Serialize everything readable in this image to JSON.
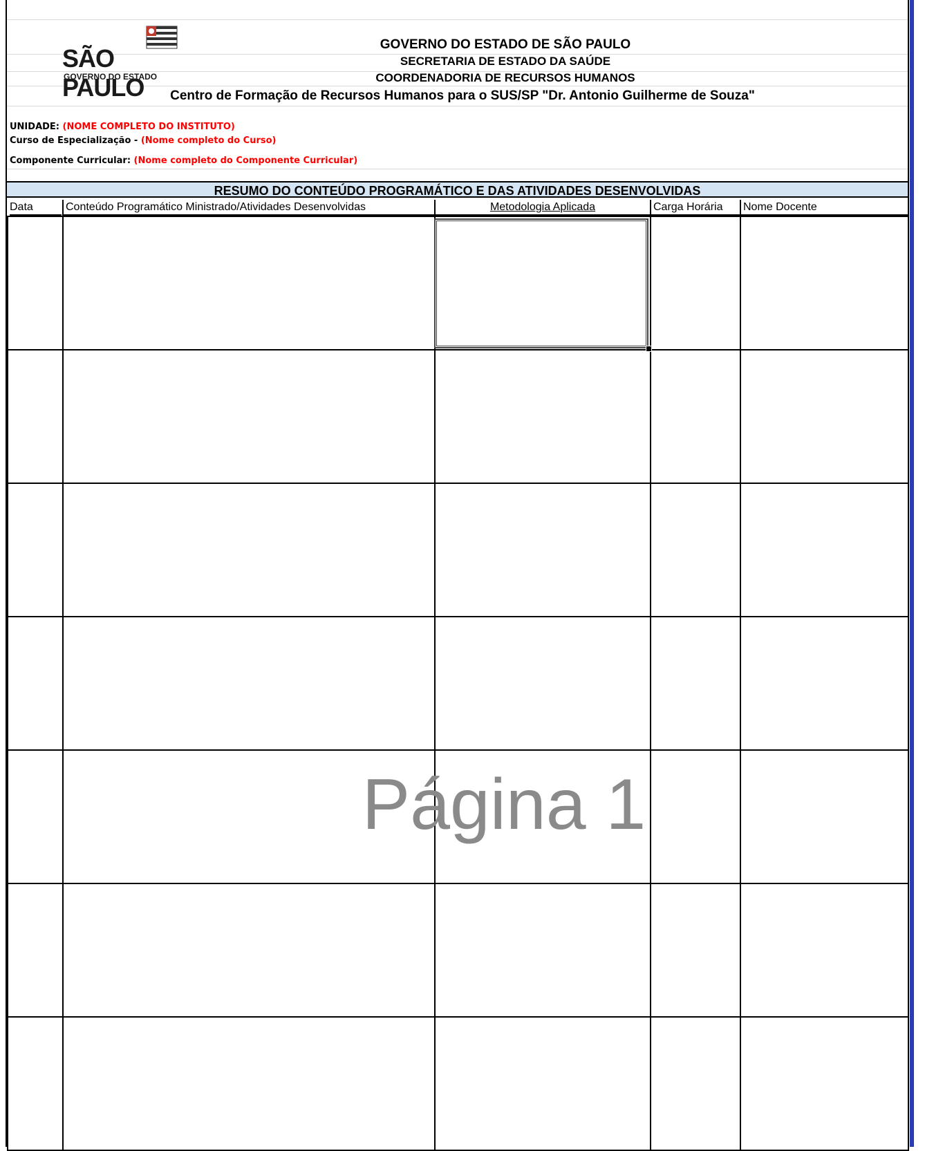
{
  "logo": {
    "name": "SÃO PAULO",
    "subtitle": "GOVERNO DO ESTADO"
  },
  "header": {
    "line1": "GOVERNO DO ESTADO DE SÃO PAULO",
    "line2": "SECRETARIA DE ESTADO DA SAÚDE",
    "line3": "COORDENADORIA DE RECURSOS HUMANOS",
    "line4": "Centro de Formação de Recursos Humanos para o SUS/SP \"Dr. Antonio Guilherme de Souza\""
  },
  "info": {
    "unidade_label": "UNIDADE:",
    "unidade_value": "(NOME COMPLETO DO INSTITUTO)",
    "curso_label": "Curso de Especialização -",
    "curso_value": "(Nome completo do Curso)",
    "componente_label": "Componente Curricular:",
    "componente_value": "(Nome completo do Componente Curricular)"
  },
  "summary_title": "RESUMO DO CONTEÚDO PROGRAMÁTICO E DAS ATIVIDADES DESENVOLVIDAS",
  "columns": {
    "data": "Data",
    "conteudo": "Conteúdo Programático Ministrado/Atividades Desenvolvidas",
    "metodologia": "Metodologia Aplicada",
    "carga": "Carga Horária",
    "docente": "Nome Docente"
  },
  "watermark": "Página 1",
  "colors": {
    "red_field": "#ff0000",
    "summary_bg": "#d5e4f2",
    "window_border": "#2b3bb3"
  }
}
